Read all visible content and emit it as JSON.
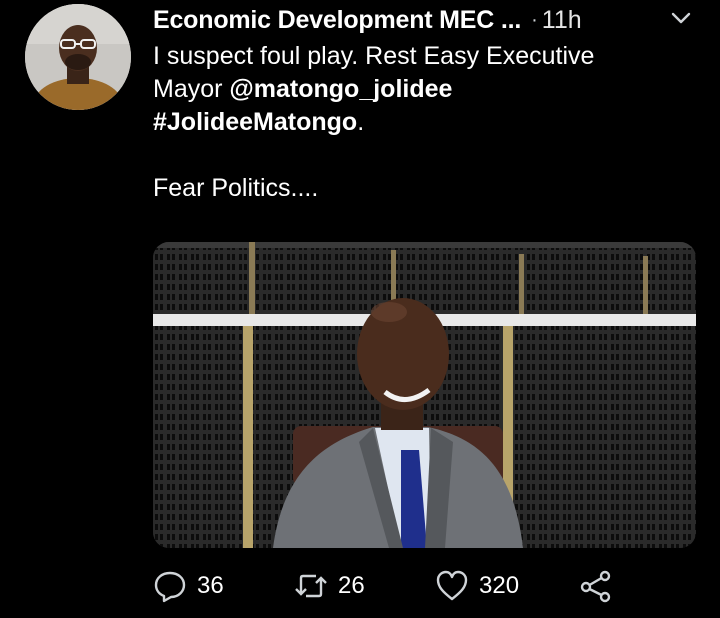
{
  "tweet": {
    "author_name": "Economic Development MEC ...",
    "separator": "·",
    "time": "11h",
    "text_line1": "I suspect foul play. Rest Easy Executive",
    "text_line2_prefix": "Mayor ",
    "mention": "@matongo_jolidee",
    "hashtag": "#JolideeMatongo",
    "hashtag_suffix": ".",
    "text_line4": "Fear Politics....",
    "media_alt": "man in grey suit and blue tie smiling in a council chamber seat"
  },
  "actions": {
    "reply_count": "36",
    "retweet_count": "26",
    "like_count": "320"
  },
  "icons": {
    "reply": "reply-icon",
    "retweet": "retweet-icon",
    "like": "heart-icon",
    "share": "share-icon",
    "caret": "chevron-down-icon"
  },
  "colors": {
    "background": "#000000",
    "text": "#ffffff",
    "icon": "#cfd3d7"
  }
}
